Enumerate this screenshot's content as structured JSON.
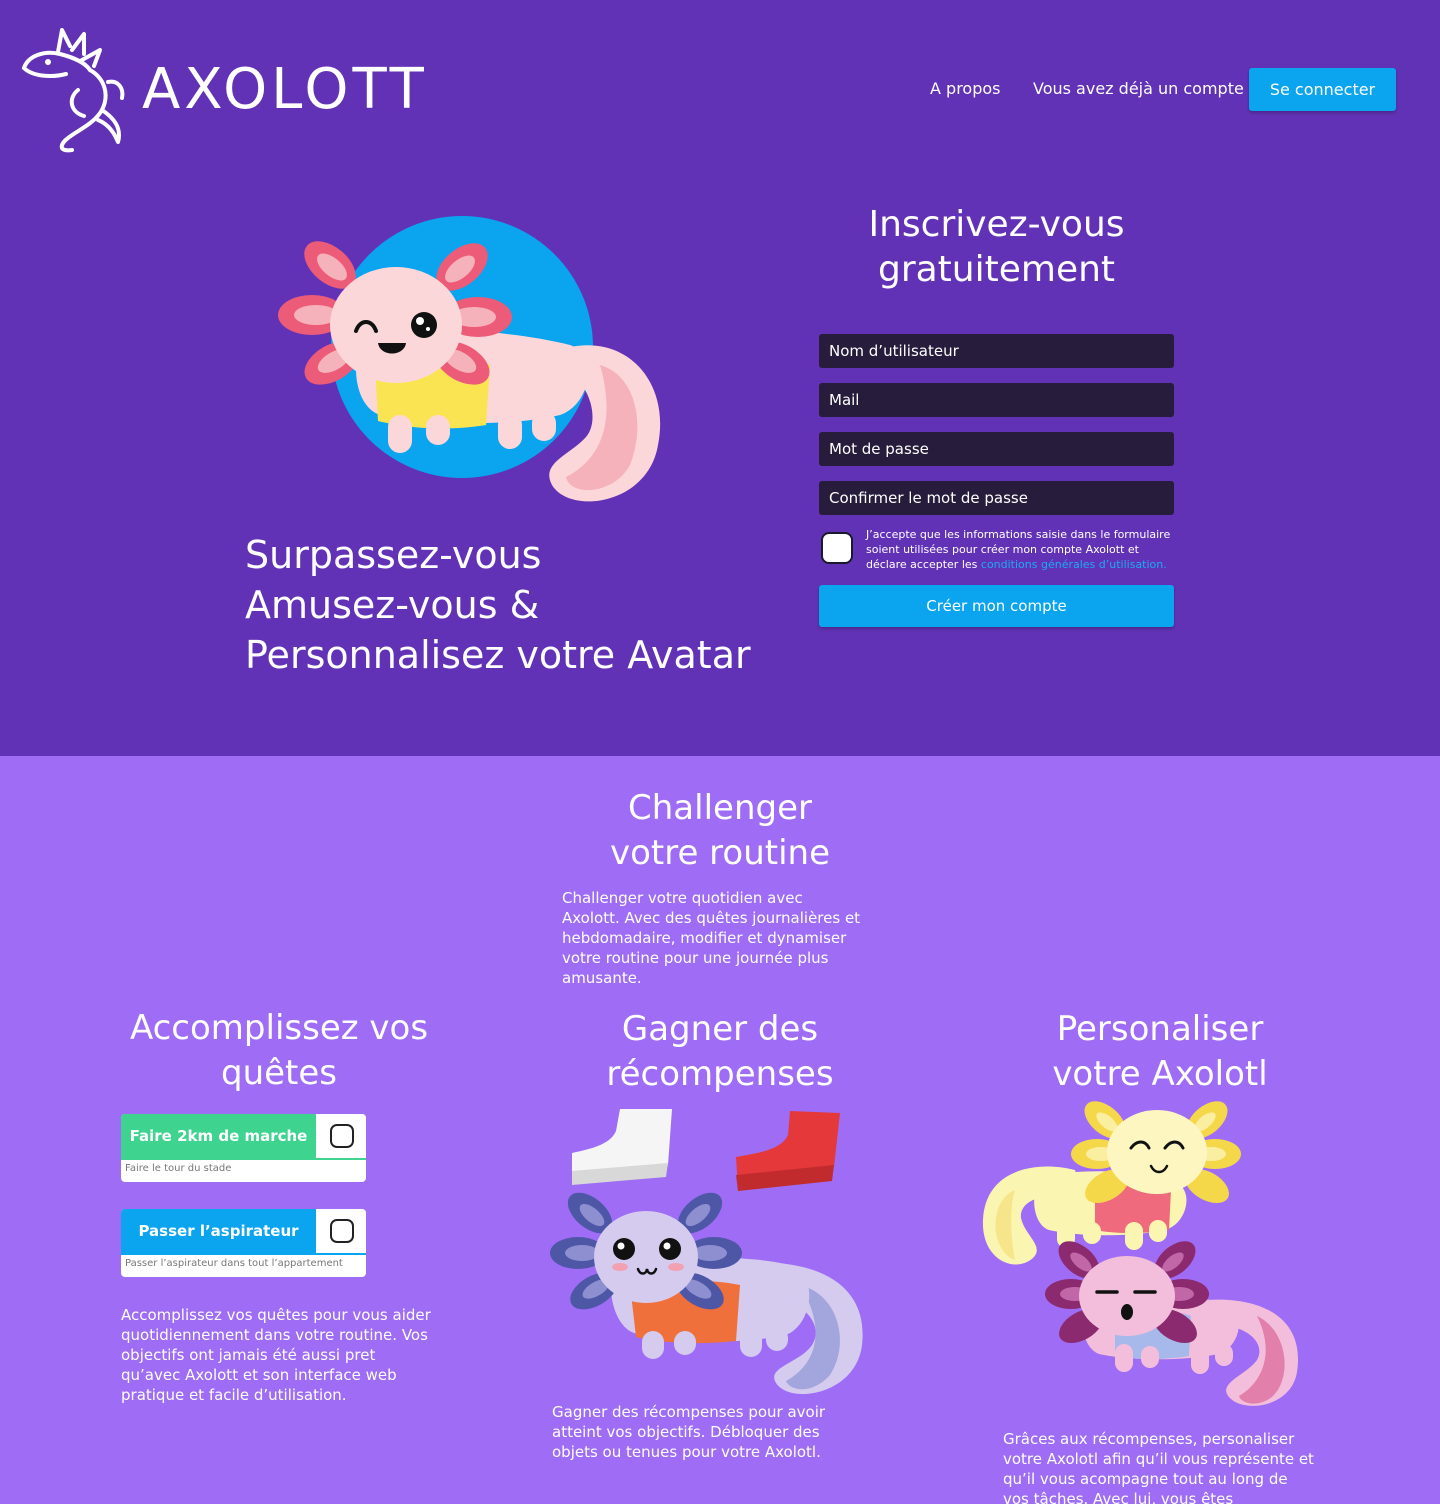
{
  "header": {
    "logo_text": "AXOLOTT",
    "nav": {
      "about": "A propos",
      "have_account": "Vous avez déjà un compte ?",
      "login_button": "Se connecter"
    }
  },
  "hero": {
    "tagline_lines": [
      "Surpassez-vous",
      "Amusez-vous &",
      "Personnalisez votre Avatar"
    ]
  },
  "signup": {
    "title_lines": [
      "Inscrivez-vous",
      "gratuitement"
    ],
    "username_placeholder": "Nom d’utilisateur",
    "mail_placeholder": "Mail",
    "password_placeholder": "Mot de passe",
    "confirm_placeholder": "Confirmer le mot de passe",
    "consent_text": "J’accepte que les informations saisie dans le formulaire soient utilisées pour créer mon compte Axolott et déclare accepter les ",
    "consent_link": "conditions générales d’utilisation.",
    "submit_label": "Créer mon compte"
  },
  "routine": {
    "title_lines": [
      "Challenger",
      "votre routine"
    ],
    "text": "Challenger votre quotidien avec Axolott. Avec des quêtes journalières et hebdomadaire, modifier et dynamiser votre routine pour une journée plus amusante."
  },
  "quests_section": {
    "title_lines": [
      "Accomplissez vos",
      "quêtes"
    ],
    "quests": [
      {
        "title": "Faire 2km de marche",
        "subtitle": "Faire le tour du stade",
        "color": "#3ed38f"
      },
      {
        "title": "Passer l’aspirateur",
        "subtitle": "Passer l’aspirateur dans tout l’appartement",
        "color": "#0ba4ef"
      }
    ],
    "text": "Accomplissez vos quêtes pour vous aider quotidiennement dans votre routine. Vos objectifs ont jamais été aussi pret qu’avec Axolott et son interface web pratique et facile d’utilisation."
  },
  "rewards_section": {
    "title_lines": [
      "Gagner des",
      "récompenses"
    ],
    "text": "Gagner des récompenses pour avoir atteint vos objectifs. Débloquer des objets ou tenues pour votre Axolotl."
  },
  "custom_section": {
    "title_lines": [
      "Personaliser",
      "votre Axolotl"
    ],
    "text": "Grâces aux récompenses, personaliser votre Axolotl afin qu’il vous représente et qu’il vous acompagne tout au long de vos tâches. Avec lui, vous êtes accompagnés."
  },
  "colors": {
    "hero_bg": "#6232b6",
    "lower_bg": "#9e6cf5",
    "accent_blue": "#0ba4ef",
    "accent_green": "#3ed38f",
    "field_bg": "#271c3b"
  }
}
